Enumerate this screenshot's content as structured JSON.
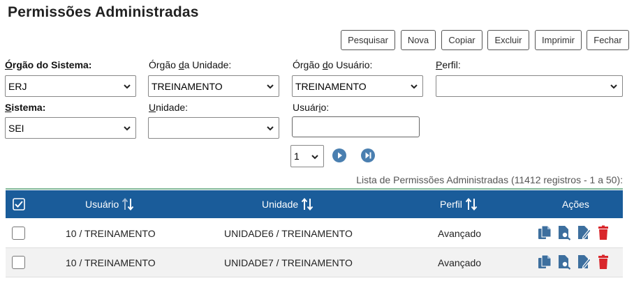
{
  "page": {
    "title": "Permissões Administradas"
  },
  "toolbar": {
    "pesquisar": "Pesquisar",
    "nova": "Nova",
    "copiar": "Copiar",
    "excluir": "Excluir",
    "imprimir": "Imprimir",
    "fechar": "Fechar"
  },
  "filters": {
    "orgao_sistema": {
      "label_u": "Ó",
      "label_rest": "rgão do Sistema:",
      "value": "ERJ"
    },
    "orgao_unidade": {
      "label_pre": "Órgão ",
      "label_u": "d",
      "label_rest": "a Unidade:",
      "value": "TREINAMENTO"
    },
    "orgao_usuario": {
      "label_pre": "Órgão ",
      "label_u": "d",
      "label_rest": "o Usuário:",
      "value": "TREINAMENTO"
    },
    "perfil": {
      "label_u": "P",
      "label_rest": "erfil:",
      "value": ""
    },
    "sistema": {
      "label_u": "S",
      "label_rest": "istema:",
      "value": "SEI"
    },
    "unidade": {
      "label_u": "U",
      "label_rest": "nidade:",
      "value": ""
    },
    "usuario": {
      "label_pre": "Usuár",
      "label_u": "i",
      "label_rest": "o:",
      "value": ""
    }
  },
  "pagination": {
    "page": "1"
  },
  "table": {
    "caption": "Lista de Permissões Administradas (11412 registros - 1 a 50):",
    "headers": {
      "usuario": "Usuário",
      "unidade": "Unidade",
      "perfil": "Perfil",
      "acoes": "Ações"
    },
    "rows": [
      {
        "usuario": "10 / TREINAMENTO",
        "unidade": "UNIDADE6 / TREINAMENTO",
        "perfil": "Avançado"
      },
      {
        "usuario": "10 / TREINAMENTO",
        "unidade": "UNIDADE7 / TREINAMENTO",
        "perfil": "Avançado"
      }
    ]
  },
  "colors": {
    "header_bg": "#1a5c9a",
    "icon_blue": "#3d6f9e",
    "delete_red": "#d9262b"
  }
}
